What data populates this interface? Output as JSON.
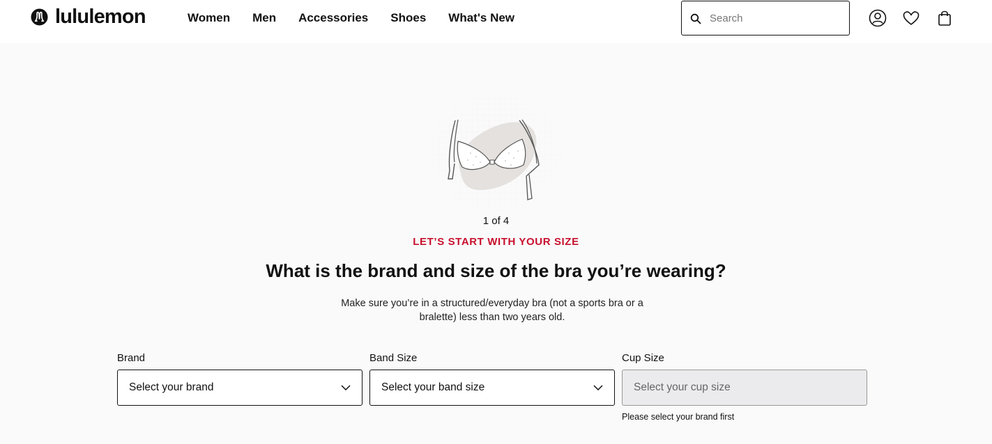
{
  "header": {
    "brand": "lululemon",
    "nav": [
      "Women",
      "Men",
      "Accessories",
      "Shoes",
      "What's New"
    ],
    "search": {
      "placeholder": "Search",
      "value": ""
    },
    "icons": [
      "account-icon",
      "wishlist-heart-icon",
      "shopping-bag-icon"
    ]
  },
  "quiz": {
    "step": "1 of 4",
    "eyebrow": "LET’S START WITH YOUR SIZE",
    "title": "What is the brand and size of the bra you’re wearing?",
    "description": "Make sure you’re in a structured/everyday bra (not a sports bra or a bralette) less than two years old.",
    "fields": [
      {
        "label": "Brand",
        "placeholder": "Select your brand",
        "disabled": false,
        "hint": ""
      },
      {
        "label": "Band Size",
        "placeholder": "Select your band size",
        "disabled": false,
        "hint": ""
      },
      {
        "label": "Cup Size",
        "placeholder": "Select your cup size",
        "disabled": true,
        "hint": "Please select your brand first"
      }
    ]
  },
  "colors": {
    "accent": "#c8102e",
    "text": "#111111",
    "background": "#fafafa",
    "disabled": "#ebebed"
  }
}
